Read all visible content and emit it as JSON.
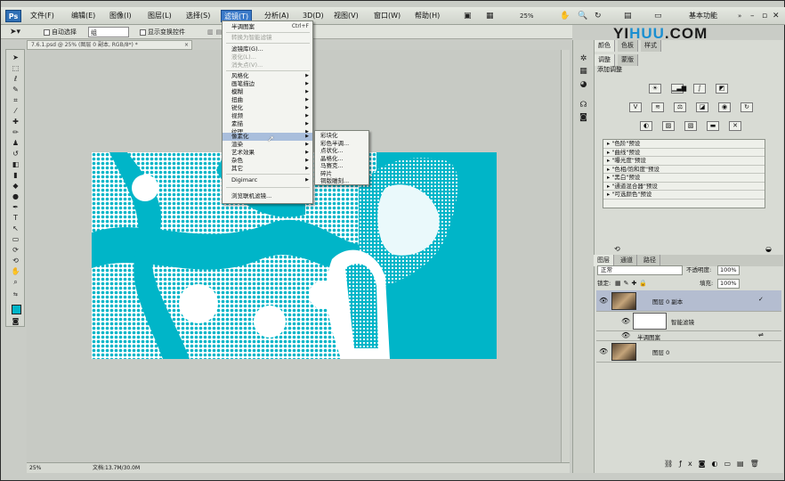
{
  "menubar": {
    "logo": "Ps",
    "items": [
      "文件(F)",
      "编辑(E)",
      "图像(I)",
      "图层(L)",
      "选择(S)",
      "滤镜(T)",
      "分析(A)",
      "3D(D)",
      "视图(V)",
      "窗口(W)",
      "帮助(H)"
    ],
    "zoom": "25%",
    "workspace": "基本功能"
  },
  "options_bar": {
    "auto_select_label": "自动选择",
    "auto_select_value": "组",
    "show_transform_label": "显示变换控件"
  },
  "document": {
    "tab_title": "7.6.1.psd @ 25% (图层 0 副本, RGB/8*) *",
    "zoom": "25%",
    "doc_info": "文档:13.7M/30.0M"
  },
  "watermark": {
    "prefix": "YI",
    "highlight": "HUU",
    "suffix": ".COM"
  },
  "panels": {
    "top_tabs": [
      "颜色",
      "色板",
      "样式"
    ],
    "adj_tabs": [
      "调整",
      "蒙版"
    ],
    "adj_title": "添加调整",
    "presets": [
      "\"色阶\"预设",
      "\"曲线\"预设",
      "\"曝光度\"预设",
      "\"色相/饱和度\"预设",
      "\"黑白\"预设",
      "\"通道混合器\"预设",
      "\"可选颜色\"预设"
    ],
    "layers_tabs": [
      "图层",
      "通道",
      "路径"
    ],
    "blend_mode": "正常",
    "opacity_label": "不透明度:",
    "opacity": "100%",
    "lock_label": "锁定:",
    "fill_label": "填充:",
    "fill": "100%",
    "layers": [
      {
        "name": "图层 0 副本"
      },
      {
        "name": "智能滤镜"
      },
      {
        "name": "半调图案"
      },
      {
        "name": "图层 0"
      }
    ]
  },
  "filter_menu": {
    "items": [
      {
        "label": "半调图案",
        "shortcut": "Ctrl+F",
        "disabled": false
      },
      {
        "label": "转换为智能滤镜",
        "disabled": true
      },
      {
        "label": "滤镜库(G)...",
        "disabled": false
      },
      {
        "label": "液化(L)...",
        "disabled": true
      },
      {
        "label": "消失点(V)...",
        "disabled": true
      },
      {
        "label": "风格化",
        "submenu": true
      },
      {
        "label": "画笔描边",
        "submenu": true
      },
      {
        "label": "模糊",
        "submenu": true
      },
      {
        "label": "扭曲",
        "submenu": true
      },
      {
        "label": "锐化",
        "submenu": true
      },
      {
        "label": "视频",
        "submenu": true
      },
      {
        "label": "素描",
        "submenu": true
      },
      {
        "label": "纹理",
        "submenu": true
      },
      {
        "label": "像素化",
        "submenu": true,
        "highlighted": true
      },
      {
        "label": "渲染",
        "submenu": true
      },
      {
        "label": "艺术效果",
        "submenu": true
      },
      {
        "label": "杂色",
        "submenu": true
      },
      {
        "label": "其它",
        "submenu": true
      },
      {
        "label": "Digimarc",
        "submenu": true
      },
      {
        "label": "浏览联机滤镜..."
      }
    ],
    "pixelate_submenu": [
      "彩块化",
      "彩色半调...",
      "点状化...",
      "晶格化...",
      "马赛克...",
      "碎片",
      "铜版雕刻..."
    ]
  },
  "colors": {
    "accent": "#00b5c8",
    "menu_highlight": "#a9bedc",
    "active_menu": "#3a79c8"
  }
}
